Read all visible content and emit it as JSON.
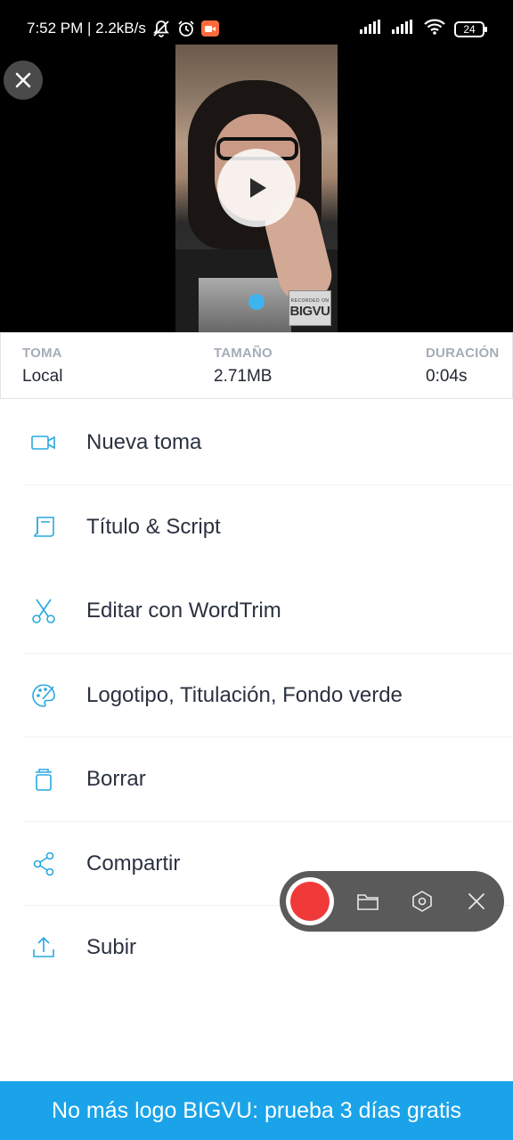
{
  "status_bar": {
    "time_speed": "7:52 PM | 2.2kB/s",
    "battery": "24"
  },
  "info": {
    "toma_label": "TOMA",
    "toma_value": "Local",
    "tamano_label": "TAMAÑO",
    "tamano_value": "2.71MB",
    "duracion_label": "DURACIÓN",
    "duracion_value": "0:04s"
  },
  "watermark": {
    "small": "RECORDED ON",
    "big": "BIGVU"
  },
  "menu": {
    "items": [
      {
        "label": "Nueva toma",
        "icon": "video-camera-icon"
      },
      {
        "label": "Título & Script",
        "icon": "script-icon"
      },
      {
        "label": "Editar con WordTrim",
        "icon": "scissors-icon"
      },
      {
        "label": "Logotipo, Titulación, Fondo verde",
        "icon": "palette-icon"
      },
      {
        "label": "Borrar",
        "icon": "trash-icon"
      },
      {
        "label": "Compartir",
        "icon": "share-icon"
      },
      {
        "label": "Subir",
        "icon": "upload-icon"
      }
    ]
  },
  "banner": {
    "text": "No más logo BIGVU: prueba 3 días gratis"
  },
  "colors": {
    "accent": "#1aa3e8",
    "icon": "#29a8e0",
    "record": "#f03a3a",
    "pill": "#5a5a5a"
  }
}
